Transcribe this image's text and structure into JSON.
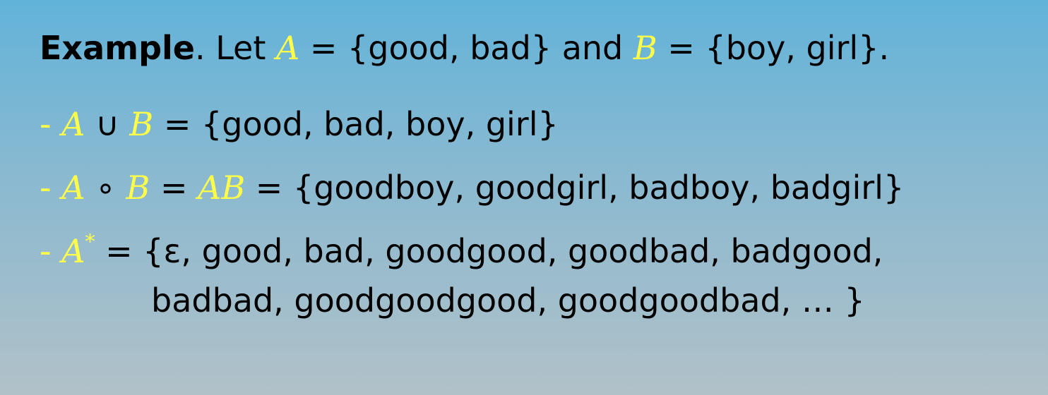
{
  "colors": {
    "highlight": "#ffff4a",
    "text": "#000000",
    "background_top": "#62b3d9",
    "background_bottom": "#b1c1c8"
  },
  "line1": {
    "title": "Example",
    "t1": ".  Let ",
    "varA": "A",
    "t2": " = {good, bad} and ",
    "varB": "B",
    "t3": " = {boy, girl}."
  },
  "line2": {
    "dash": "- ",
    "varA": "A",
    "op": " ∪ ",
    "varB": "B",
    "rest": " = {good, bad, boy, girl}"
  },
  "line3": {
    "dash": "- ",
    "varA": "A",
    "op": " ∘ ",
    "varB": "B",
    "eq": " = ",
    "varAB": "AB",
    "rest": " = {goodboy, goodgirl, badboy, badgirl}"
  },
  "line4": {
    "dash": "- ",
    "varA": "A",
    "star": "*",
    "rest": " =  {ε, good, bad, goodgood, goodbad, badgood,"
  },
  "line5": {
    "rest": "badbad, goodgoodgood, goodgoodbad, … }"
  }
}
